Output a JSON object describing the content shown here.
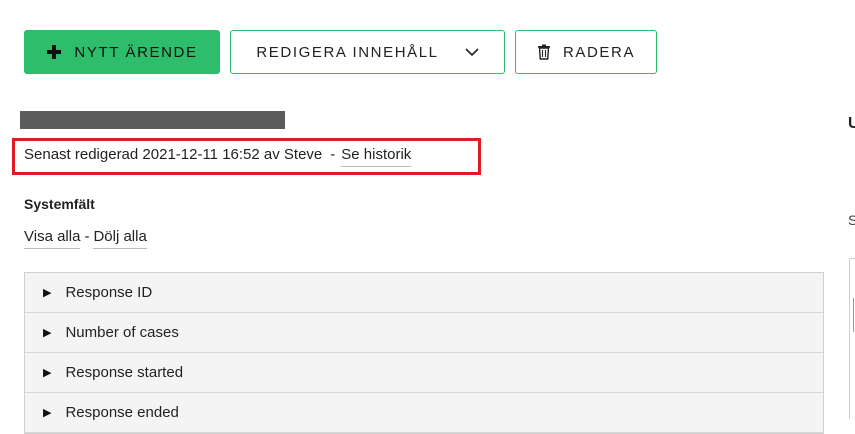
{
  "toolbar": {
    "new_case_label": "NYTT ÄRENDE",
    "edit_content_label": "REDIGERA INNEHÅLL",
    "delete_label": "RADERA"
  },
  "record": {
    "edited_text": "Senast redigerad 2021-12-11 16:52 av Steve",
    "separator": "-",
    "history_link": "Se historik"
  },
  "system_fields": {
    "title": "Systemfält",
    "show_all": "Visa alla",
    "dash": "-",
    "hide_all": "Dölj alla",
    "items": [
      {
        "label": "Response ID"
      },
      {
        "label": "Number of cases"
      },
      {
        "label": "Response started"
      },
      {
        "label": "Response ended"
      }
    ]
  },
  "right_panel": {
    "heading_fragment": "U",
    "text_fragment": "S"
  },
  "colors": {
    "accent": "#2ebd6b",
    "highlight": "#e01b24",
    "redaction": "#5b5b5b"
  }
}
